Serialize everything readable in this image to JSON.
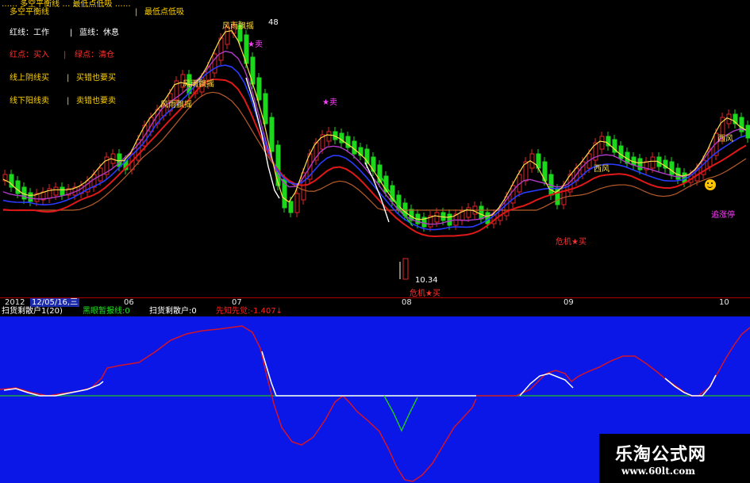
{
  "top_strip": "…… 多空平衡线 … 最低点低吸 ……",
  "legend": {
    "row1_left": "多空平衡线",
    "row1_right": "最低点低吸",
    "row2_left": "红线：工作",
    "row2_right": "蓝线：休息",
    "row3_left": "红点：买入",
    "row3_right": "绿点：清仓",
    "row4_left": "线上阴线买",
    "row4_right": "买错也要买",
    "row5_left": "线下阳线卖",
    "row5_right": "卖错也要卖",
    "sep": "|"
  },
  "annotations": {
    "fengyu_1": "风雨飘摇",
    "fengyu_2": "风雨飘摇",
    "fengyu_3": "风雨飘摇",
    "high_value": "48",
    "sell_1": "★卖",
    "sell_2": "★卖",
    "low_value": "10.34",
    "weiji_1": "危机★买",
    "weiji_2": "危机★买",
    "xifeng_1": "西风",
    "xifeng_2": "西风",
    "zhuizhang": "追涨停"
  },
  "axis": {
    "year": "2012",
    "date": "12/05/16,三",
    "months": [
      "06",
      "07",
      "08",
      "09",
      "10"
    ]
  },
  "indicator_header": {
    "name": "扫货剩散户1(20)",
    "item1": "黑眼暂报线:0",
    "item2": "扫货剩散户:0",
    "item3": "先知先觉:-1.407↓"
  },
  "watermark": {
    "title": "乐淘公式网",
    "url": "www.60lt.com"
  },
  "colors": {
    "background": "#000000",
    "panel_blue": "#0a17e6",
    "up_candle": "#e0262a",
    "down_candle": "#1fd61f",
    "ma_red": "#e01818",
    "ma_blue": "#2b3bff",
    "ma_purple": "#b03cc8",
    "ma_yellow": "#ffe04a",
    "ma_white": "#ffffff",
    "legend_yellow": "#ffd200",
    "legend_red": "#ff3030",
    "annotation_magenta": "#ff40ff"
  }
}
